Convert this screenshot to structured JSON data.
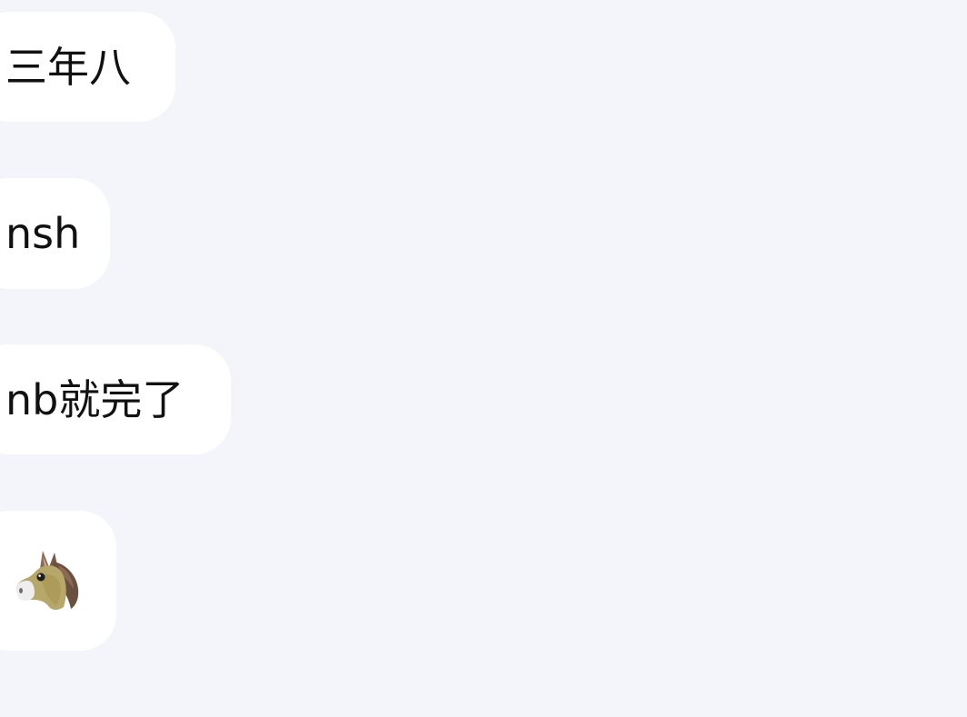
{
  "messages": [
    {
      "type": "text",
      "text": "三年八"
    },
    {
      "type": "text",
      "text": "nsh"
    },
    {
      "type": "text",
      "text": "nb就完了"
    },
    {
      "type": "emoji",
      "icon": "horse-face-icon"
    }
  ],
  "colors": {
    "background": "#f4f5fa",
    "bubble": "#ffffff",
    "text": "#111111"
  }
}
